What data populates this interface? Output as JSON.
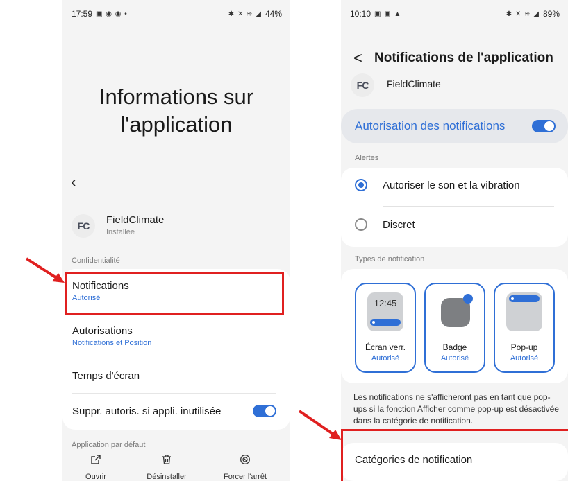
{
  "left": {
    "status": {
      "time": "17:59",
      "left_glyphs": "▣ ◉ ◉ •",
      "right_glyphs": "✱ ✕ ≋ ◢",
      "battery": "44%"
    },
    "title": "Informations sur l'application",
    "back": "‹",
    "app": {
      "icon_text": "FC",
      "name": "FieldClimate",
      "status": "Installée"
    },
    "privacy_label": "Confidentialité",
    "rows": {
      "notifications": {
        "title": "Notifications",
        "sub": "Autorisé"
      },
      "autorisations": {
        "title": "Autorisations",
        "sub": "Notifications et Position"
      },
      "screen_time": {
        "title": "Temps d'écran"
      },
      "remove_perms": {
        "title": "Suppr. autoris. si appli. inutilisée",
        "toggle": "on"
      }
    },
    "default_label": "Application par défaut",
    "bottom_bar": {
      "open": {
        "icon": "open-external-icon",
        "label": "Ouvrir"
      },
      "uninstall": {
        "icon": "trash-icon",
        "label": "Désinstaller"
      },
      "force_stop": {
        "icon": "stop-icon",
        "label": "Forcer l'arrêt"
      }
    }
  },
  "right": {
    "status": {
      "time": "10:10",
      "left_glyphs": "▣ ▣ ▲",
      "right_glyphs": "✱ ✕ ≋ ◢",
      "battery": "89%"
    },
    "title": "Notifications de l'application",
    "back": "<",
    "app": {
      "icon_text": "FC",
      "name": "FieldClimate"
    },
    "allow": {
      "label": "Autorisation des notifications",
      "toggle": "on"
    },
    "alerts_label": "Alertes",
    "alerts": [
      {
        "label": "Autoriser le son et la vibration",
        "selected": true
      },
      {
        "label": "Discret",
        "selected": false
      }
    ],
    "types_label": "Types de notification",
    "types": [
      {
        "title": "Écran verr.",
        "sub": "Autorisé",
        "preview_time": "12:45"
      },
      {
        "title": "Badge",
        "sub": "Autorisé"
      },
      {
        "title": "Pop-up",
        "sub": "Autorisé"
      }
    ],
    "info": "Les notifications ne s'afficheront pas en tant que pop-ups si la fonction Afficher comme pop-up est désactivée dans la catégorie de notification.",
    "categories": "Catégories de notification"
  },
  "colors": {
    "accent": "#2f6fd6",
    "highlight": "#e02020",
    "background": "#f4f4f4"
  }
}
